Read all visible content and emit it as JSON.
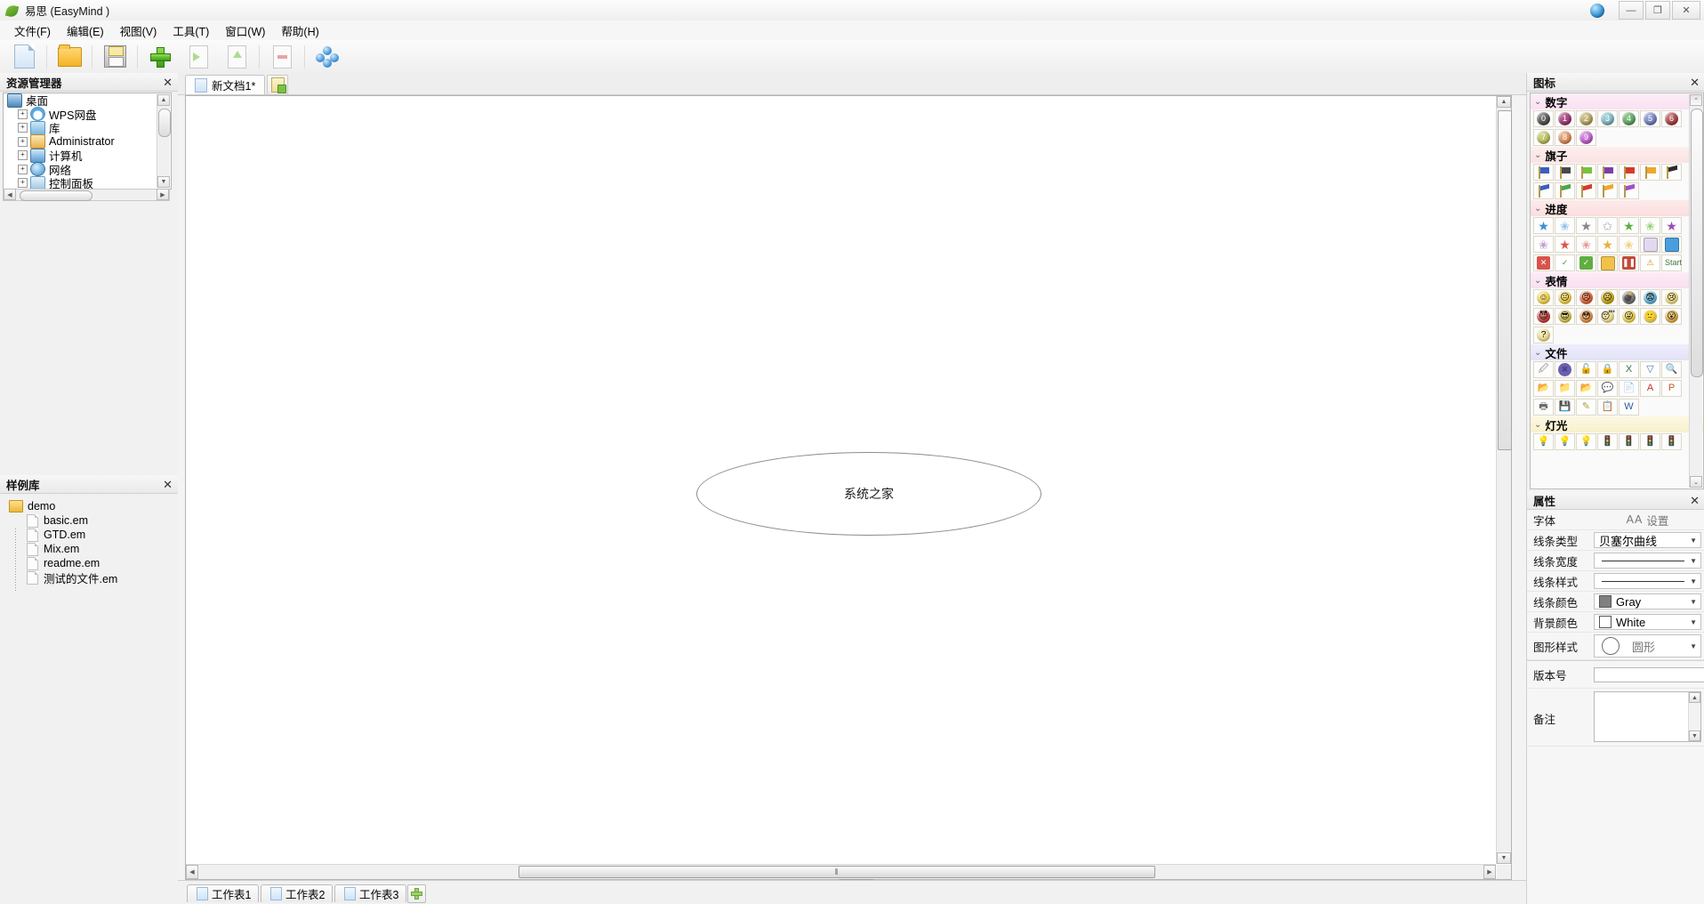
{
  "window": {
    "app_icon": "leaf-icon",
    "title": "易思 (EasyMind )",
    "globe_icon": "globe-icon",
    "minimize": "—",
    "maximize": "❐",
    "close": "✕"
  },
  "menubar": {
    "items": [
      {
        "label": "文件(F)",
        "name": "menu-file"
      },
      {
        "label": "编辑(E)",
        "name": "menu-edit"
      },
      {
        "label": "视图(V)",
        "name": "menu-view"
      },
      {
        "label": "工具(T)",
        "name": "menu-tools"
      },
      {
        "label": "窗口(W)",
        "name": "menu-window"
      },
      {
        "label": "帮助(H)",
        "name": "menu-help"
      }
    ]
  },
  "toolbar": {
    "buttons": [
      {
        "name": "new-document-button",
        "icon": "new-document-icon"
      },
      {
        "name": "open-document-button",
        "icon": "open-folder-icon"
      },
      {
        "name": "save-document-button",
        "icon": "save-disk-icon"
      },
      {
        "name": "add-node-button",
        "icon": "green-plus-icon"
      },
      {
        "name": "add-sibling-node-button",
        "icon": "page-right-arrow-icon"
      },
      {
        "name": "add-child-node-button",
        "icon": "page-up-arrow-icon"
      },
      {
        "name": "delete-node-button",
        "icon": "page-minus-icon"
      },
      {
        "name": "group-button",
        "icon": "blue-bubbles-icon"
      }
    ]
  },
  "explorer": {
    "title": "资源管理器",
    "close_icon": "✕",
    "tree": [
      {
        "label": "桌面",
        "icon": "desktop-icon",
        "level": 0,
        "expander": ""
      },
      {
        "label": "WPS网盘",
        "icon": "cloud-icon",
        "level": 1,
        "expander": "+"
      },
      {
        "label": "库",
        "icon": "library-icon",
        "level": 1,
        "expander": "+"
      },
      {
        "label": "Administrator",
        "icon": "user-icon",
        "level": 1,
        "expander": "+"
      },
      {
        "label": "计算机",
        "icon": "computer-icon",
        "level": 1,
        "expander": "+"
      },
      {
        "label": "网络",
        "icon": "network-icon",
        "level": 1,
        "expander": "+"
      },
      {
        "label": "控制面板",
        "icon": "control-panel-icon",
        "level": 1,
        "expander": "+"
      }
    ],
    "scroll_up": "▲",
    "scroll_down": "▼",
    "scroll_left": "◀",
    "scroll_right": "▶"
  },
  "sample_library": {
    "title": "样例库",
    "close_icon": "✕",
    "root": {
      "label": "demo",
      "icon": "folder-icon"
    },
    "files": [
      {
        "label": "basic.em",
        "icon": "file-icon"
      },
      {
        "label": "GTD.em",
        "icon": "file-icon"
      },
      {
        "label": "Mix.em",
        "icon": "file-icon"
      },
      {
        "label": "readme.em",
        "icon": "file-icon"
      },
      {
        "label": "测试的文件.em",
        "icon": "file-icon"
      }
    ]
  },
  "document": {
    "tab_label": "新文档1*",
    "tab_icon": "document-icon",
    "new_document_icon": "new-document-plus-icon",
    "node_text": "系统之家",
    "h_scroll_grip": "⦀",
    "collapse_handle": "△",
    "scroll_left": "◀",
    "scroll_right": "▶",
    "scroll_up": "▲",
    "scroll_down": "▼"
  },
  "sheets": {
    "tabs": [
      {
        "label": "工作表1",
        "icon": "sheet-icon"
      },
      {
        "label": "工作表2",
        "icon": "sheet-icon"
      },
      {
        "label": "工作表3",
        "icon": "sheet-icon"
      }
    ],
    "add_label": "add-sheet-icon"
  },
  "icons_panel": {
    "title": "图标",
    "close_icon": "✕",
    "chevron": "⌄",
    "categories": [
      {
        "name": "数字",
        "rows": [
          [
            {
              "glyph": "0",
              "bg": "#4a4a4a"
            },
            {
              "glyph": "1",
              "bg": "#9c2f6e"
            },
            {
              "glyph": "2",
              "bg": "#b8a35c"
            },
            {
              "glyph": "3",
              "bg": "#7bb8c4"
            },
            {
              "glyph": "4",
              "bg": "#5aa55a"
            },
            {
              "glyph": "5",
              "bg": "#6f7fc0"
            },
            {
              "glyph": "6",
              "bg": "#a43b3b"
            }
          ],
          [
            {
              "glyph": "7",
              "bg": "#b9be58"
            },
            {
              "glyph": "8",
              "bg": "#e08a55"
            },
            {
              "glyph": "9",
              "bg": "#c25bd0"
            }
          ]
        ]
      },
      {
        "name": "旗子",
        "rows": [
          [
            {
              "kind": "flag",
              "bg": "#3b5fc0"
            },
            {
              "kind": "flag",
              "bg": "#4a4a4a"
            },
            {
              "kind": "flag",
              "bg": "#79c23a"
            },
            {
              "kind": "flag",
              "bg": "#7b3fa8"
            },
            {
              "kind": "flag",
              "bg": "#d83a2a"
            },
            {
              "kind": "flag",
              "bg": "#f0a72a"
            },
            {
              "kind": "flag2",
              "bg": "#2b2b2b"
            }
          ],
          [
            {
              "kind": "flag2",
              "bg": "#3b5fc0"
            },
            {
              "kind": "flag2",
              "bg": "#49a84b"
            },
            {
              "kind": "flag2",
              "bg": "#d83a2a"
            },
            {
              "kind": "flag2",
              "bg": "#f0a72a"
            },
            {
              "kind": "flag2",
              "bg": "#a24fc0"
            }
          ]
        ]
      },
      {
        "name": "进度",
        "rows": [
          [
            {
              "glyph": "★",
              "color": "#3f8fd0"
            },
            {
              "glyph": "✬",
              "color": "#8fc2e8"
            },
            {
              "glyph": "★",
              "color": "#888888"
            },
            {
              "glyph": "✩",
              "color": "#aaaaaa"
            },
            {
              "glyph": "★",
              "color": "#5fae3f"
            },
            {
              "glyph": "✬",
              "color": "#9bd07a"
            },
            {
              "glyph": "★",
              "color": "#9b4fb0"
            }
          ],
          [
            {
              "glyph": "✬",
              "color": "#c69ad4"
            },
            {
              "glyph": "★",
              "color": "#d9554a"
            },
            {
              "glyph": "✬",
              "color": "#e39a93"
            },
            {
              "glyph": "★",
              "color": "#e8b234"
            },
            {
              "glyph": "✬",
              "color": "#f0d07a"
            },
            {
              "kind": "sq",
              "bg": "#e3d8ef"
            },
            {
              "kind": "sq",
              "bg": "#4a9ede"
            }
          ],
          [
            {
              "glyph": "✕",
              "color": "#ffffff",
              "bg": "#d8544a"
            },
            {
              "glyph": "✓",
              "color": "#4e9b3c",
              "bg": "#ffffff"
            },
            {
              "glyph": "✓",
              "color": "#ffffff",
              "bg": "#5fae3f"
            },
            {
              "kind": "sq",
              "bg": "#f0c24a"
            },
            {
              "glyph": "❚❚",
              "color": "#ffffff",
              "bg": "#c44a3a"
            },
            {
              "glyph": "⚠",
              "color": "#d08a00",
              "bg": "#ffffff"
            },
            {
              "glyph": "Start",
              "color": "#3a7a3a",
              "bg": "#ffffff"
            }
          ]
        ]
      },
      {
        "name": "表情",
        "rows": [
          [
            {
              "glyph": "☺",
              "bg": "#f4d03f"
            },
            {
              "glyph": "😐",
              "bg": "#f4d03f"
            },
            {
              "glyph": "😠",
              "bg": "#e05a2a"
            },
            {
              "glyph": "☹",
              "bg": "#c8a400"
            },
            {
              "glyph": "💣",
              "bg": "#6b6b6b"
            },
            {
              "glyph": "😨",
              "bg": "#5ab0d8"
            },
            {
              "glyph": "😢",
              "bg": "#f0de7a"
            }
          ],
          [
            {
              "glyph": "😈",
              "bg": "#c4332a"
            },
            {
              "glyph": "😎",
              "bg": "#d8c34a"
            },
            {
              "glyph": "😳",
              "bg": "#e08a3a"
            },
            {
              "glyph": "😴",
              "bg": "#f0dc8a"
            },
            {
              "glyph": "😜",
              "bg": "#f4d84a"
            },
            {
              "glyph": "🙂",
              "bg": "#f4d84a"
            },
            {
              "glyph": "😮",
              "bg": "#e0a83a"
            }
          ],
          [
            {
              "glyph": "?",
              "bg": "#f0dc8a"
            }
          ]
        ]
      },
      {
        "name": "文件",
        "rows": [
          [
            {
              "glyph": "🖉",
              "color": "#8a8a8a"
            },
            {
              "glyph": "✖",
              "color": "#4a3f8a",
              "bg": "#6b5fb0",
              "round": true
            },
            {
              "glyph": "🔓",
              "color": "#b09a4a"
            },
            {
              "glyph": "🔒",
              "color": "#8a7a3a"
            },
            {
              "glyph": "X",
              "color": "#2f7a3f"
            },
            {
              "glyph": "▽",
              "color": "#4a7ab0"
            },
            {
              "glyph": "🔍",
              "color": "#3a6fa8"
            }
          ],
          [
            {
              "glyph": "📂",
              "color": "#e0a82a"
            },
            {
              "glyph": "📁",
              "color": "#e8c05a"
            },
            {
              "glyph": "📂",
              "color": "#d89a2a"
            },
            {
              "glyph": "💬",
              "color": "#4fae4f"
            },
            {
              "glyph": "📄",
              "color": "#bbbbbb"
            },
            {
              "glyph": "A",
              "color": "#c4332a"
            },
            {
              "glyph": "P",
              "color": "#c4552a"
            }
          ],
          [
            {
              "glyph": "🖶",
              "color": "#6a6a6a"
            },
            {
              "glyph": "💾",
              "color": "#5a5a8a"
            },
            {
              "glyph": "✎",
              "color": "#b09a3a"
            },
            {
              "glyph": "📋",
              "color": "#8a8a6a"
            },
            {
              "glyph": "W",
              "color": "#2a5aa8"
            }
          ]
        ]
      },
      {
        "name": "灯光",
        "rows": [
          [
            {
              "glyph": "💡",
              "color": "#e8d04a"
            },
            {
              "glyph": "💡",
              "color": "#c8d0d8"
            },
            {
              "glyph": "💡",
              "color": "#f0a82a"
            },
            {
              "glyph": "🚦",
              "color": "#8a5a2a"
            },
            {
              "glyph": "🚦",
              "color": "#6a6a6a"
            },
            {
              "glyph": "🚦",
              "color": "#c4332a"
            },
            {
              "glyph": "🚦",
              "color": "#8a7a4a"
            }
          ]
        ]
      }
    ]
  },
  "properties": {
    "title": "属性",
    "close_icon": "✕",
    "rows": [
      {
        "label": "字体",
        "value": "设置",
        "kind": "font",
        "icon": "font-settings-icon"
      },
      {
        "label": "线条类型",
        "value": "贝塞尔曲线",
        "kind": "select"
      },
      {
        "label": "线条宽度",
        "value": "",
        "kind": "line-thin"
      },
      {
        "label": "线条样式",
        "value": "",
        "kind": "line-solid"
      },
      {
        "label": "线条颜色",
        "value": "Gray",
        "kind": "color",
        "swatch": "#808080"
      },
      {
        "label": "背景颜色",
        "value": "White",
        "kind": "color",
        "swatch": "#ffffff"
      },
      {
        "label": "图形样式",
        "value": "圆形",
        "kind": "shape"
      }
    ],
    "version": {
      "label": "版本号",
      "value": ""
    },
    "note": {
      "label": "备注",
      "value": "",
      "scroll_up": "▲",
      "scroll_down": "▼"
    }
  }
}
